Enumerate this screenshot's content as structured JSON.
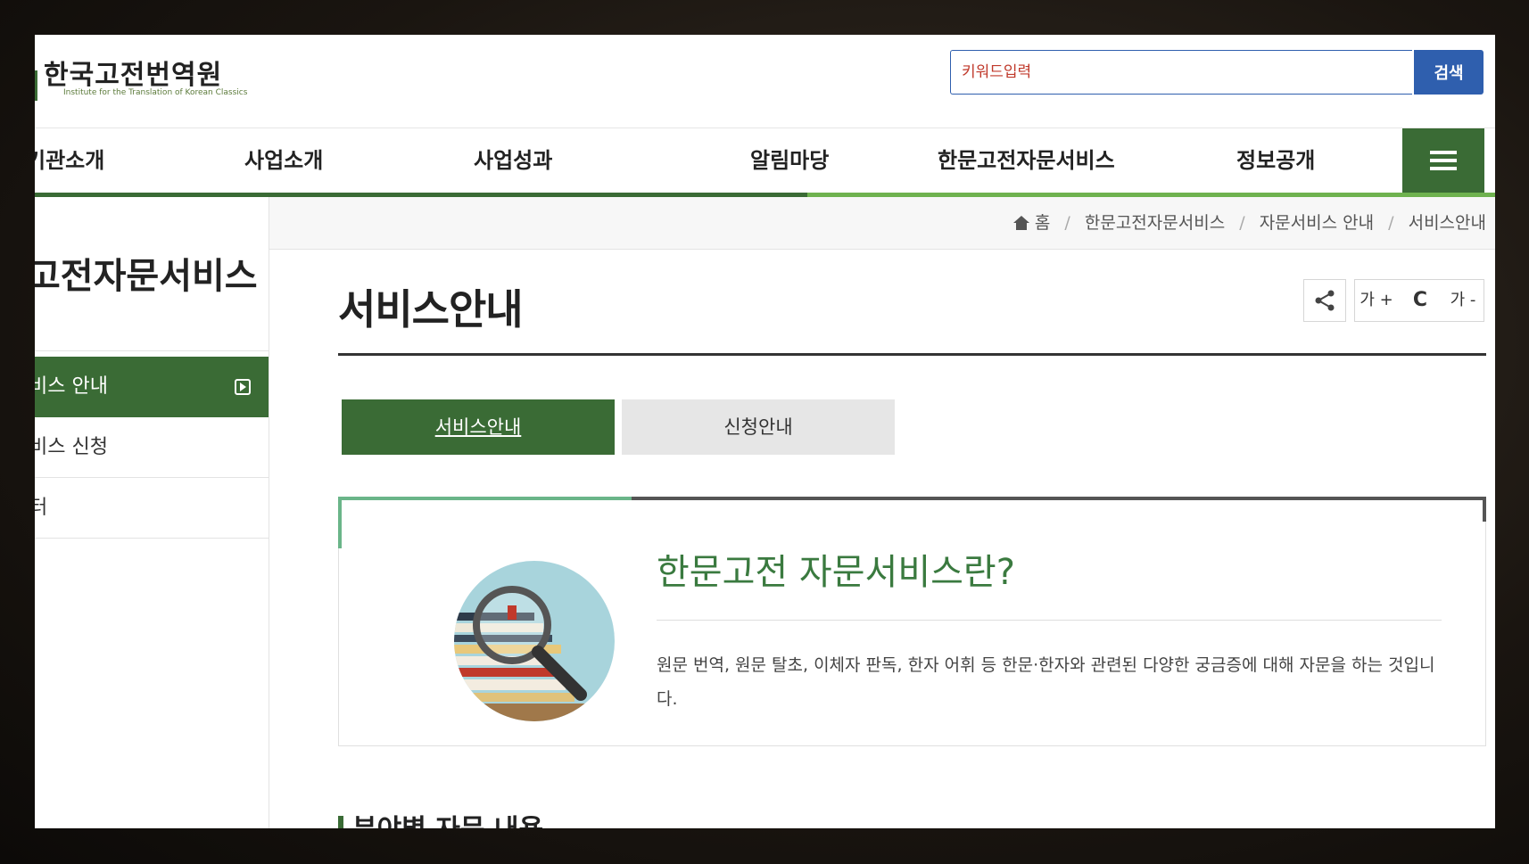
{
  "header": {
    "logo_title": "한국고전번역원",
    "logo_subtitle": "Institute for the Translation of Korean Classics",
    "search_placeholder": "키워드입력",
    "search_button": "검색"
  },
  "gnb": {
    "items": [
      "기관소개",
      "사업소개",
      "사업성과",
      "알림마당",
      "한문고전자문서비스",
      "정보공개"
    ],
    "menu_icon": "hamburger-icon"
  },
  "sidebar": {
    "title": "고전자문서비스",
    "items": [
      {
        "label": "비스 안내",
        "active": true
      },
      {
        "label": "비스 신청",
        "active": false
      },
      {
        "label": "터",
        "active": false
      }
    ]
  },
  "breadcrumb": {
    "home": "홈",
    "items": [
      "한문고전자문서비스",
      "자문서비스 안내",
      "서비스안내"
    ]
  },
  "content": {
    "title": "서비스안내",
    "tools": {
      "share_icon": "share-icon",
      "font_up": "가 +",
      "refresh": "C",
      "font_down": "가 -"
    },
    "tabs": [
      {
        "label": "서비스안내",
        "active": true
      },
      {
        "label": "신청안내",
        "active": false
      }
    ],
    "card": {
      "title": "한문고전 자문서비스란?",
      "description": "원문 번역, 원문 탈초, 이체자 판독, 한자 어휘 등 한문·한자와 관련된 다양한 궁금증에 대해 자문을 하는 것입니다."
    },
    "section_heading": "분야별 자문 내용"
  },
  "colors": {
    "brand_green": "#3a6b35",
    "light_green": "#6fb24f",
    "search_blue": "#2f5fae",
    "card_title_green": "#3a7a3f"
  }
}
